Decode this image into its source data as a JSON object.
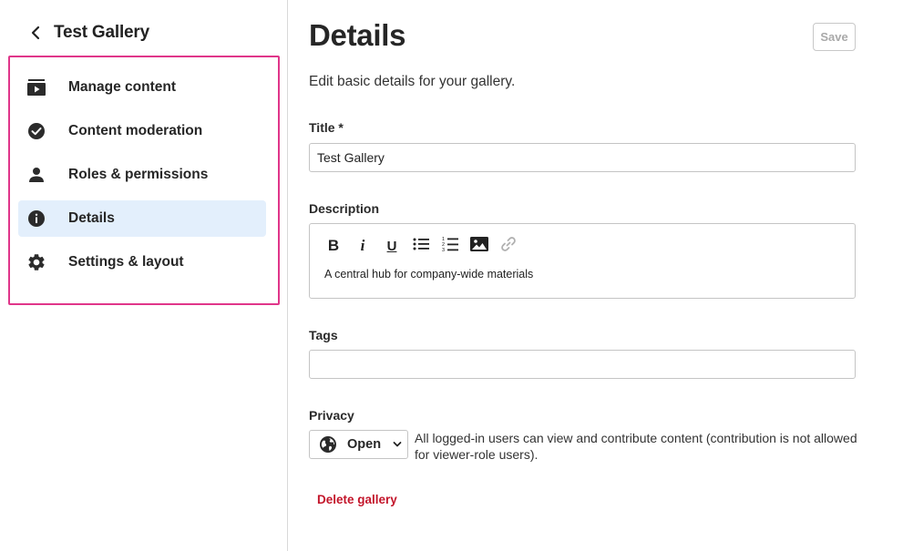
{
  "sidebar": {
    "back_title": "Test Gallery",
    "items": [
      {
        "label": "Manage content",
        "icon": "play-box-icon"
      },
      {
        "label": "Content moderation",
        "icon": "check-circle-icon"
      },
      {
        "label": "Roles & permissions",
        "icon": "person-icon"
      },
      {
        "label": "Details",
        "icon": "info-icon",
        "active": true
      },
      {
        "label": "Settings & layout",
        "icon": "gear-icon"
      }
    ]
  },
  "header": {
    "title": "Details",
    "save_label": "Save",
    "subtitle": "Edit basic details for your gallery."
  },
  "form": {
    "title_label": "Title *",
    "title_value": "Test Gallery",
    "description_label": "Description",
    "description_value": "A central hub for company-wide materials",
    "toolbar": {
      "bold": "B",
      "italic": "i",
      "underline": "U"
    },
    "tags_label": "Tags",
    "tags_value": "",
    "privacy_label": "Privacy",
    "privacy_value": "Open",
    "privacy_description": "All logged-in users can view and contribute content (contribution is not allowed for viewer-role users).",
    "delete_label": "Delete gallery"
  },
  "colors": {
    "highlight_border": "#e0368a",
    "active_bg": "#e3effc",
    "danger": "#c3162b"
  }
}
